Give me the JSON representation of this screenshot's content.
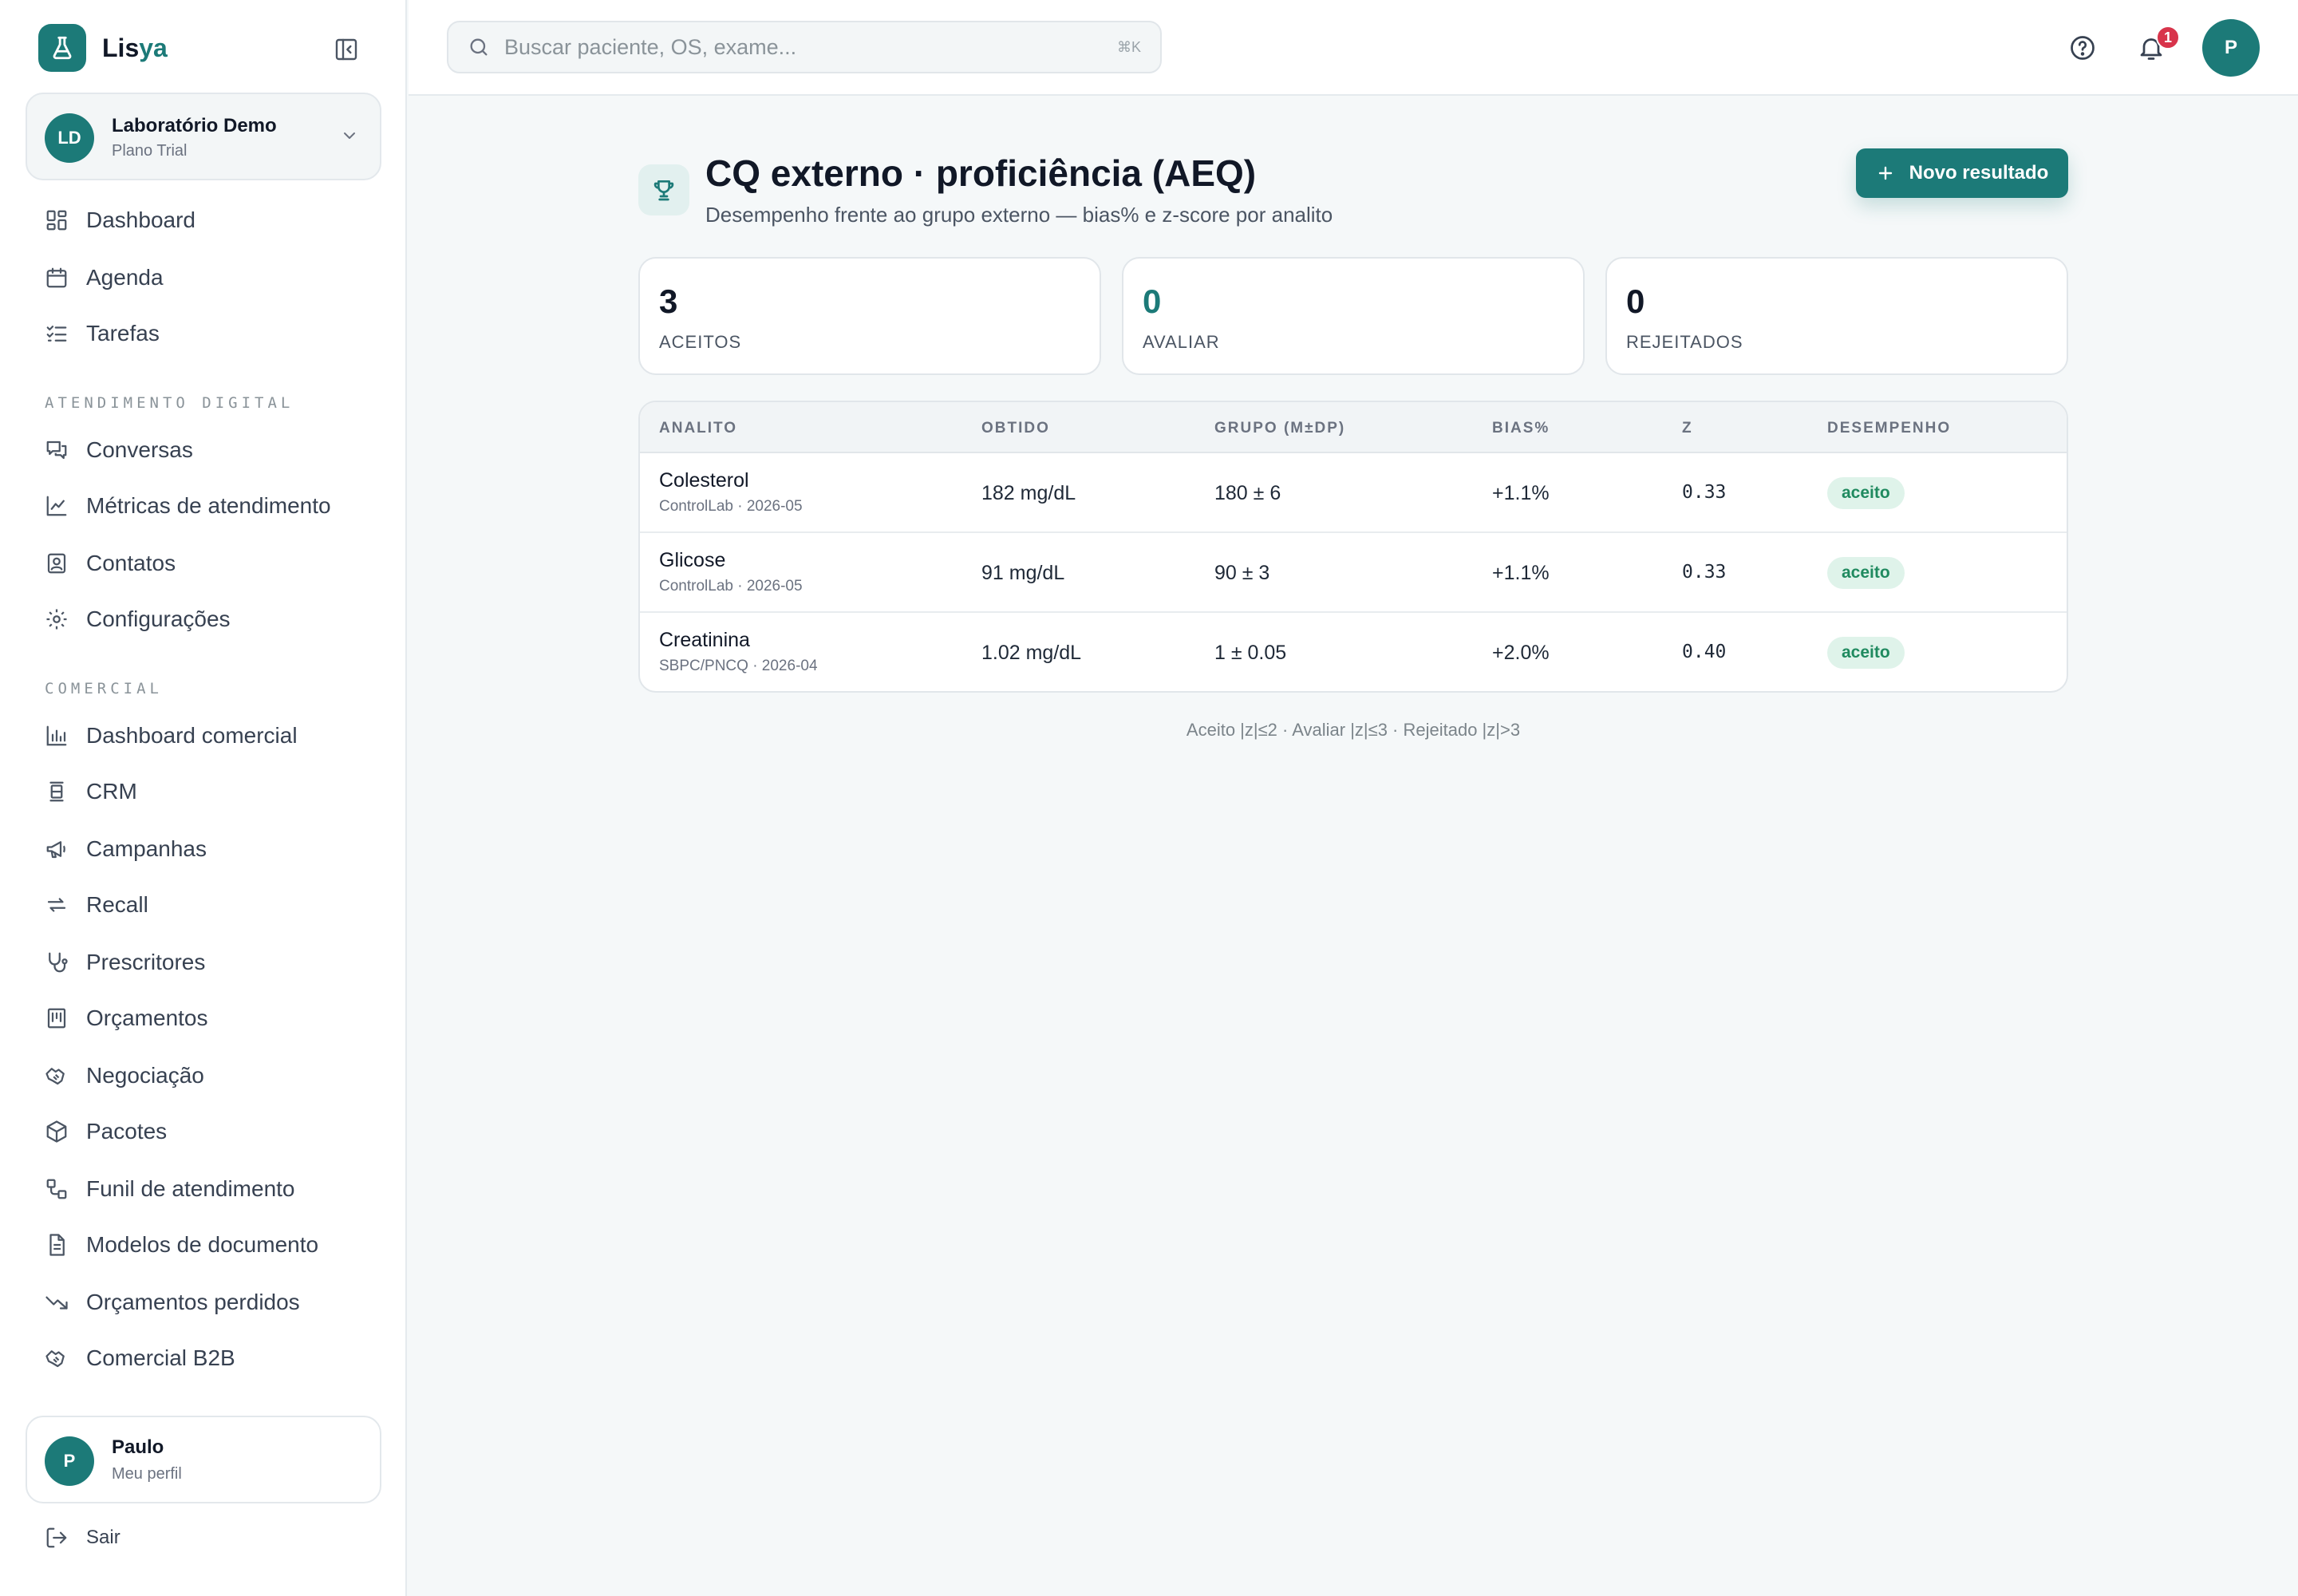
{
  "app": {
    "brand_prefix": "Lis",
    "brand_suffix": "ya"
  },
  "org": {
    "initials": "LD",
    "name": "Laboratório Demo",
    "plan": "Plano Trial"
  },
  "sidebar": {
    "main_items": [
      {
        "label": "Dashboard",
        "icon": "dashboard-grid-icon"
      },
      {
        "label": "Agenda",
        "icon": "calendar-icon"
      },
      {
        "label": "Tarefas",
        "icon": "checklist-icon"
      }
    ],
    "section_digital": "ATENDIMENTO DIGITAL",
    "digital_items": [
      {
        "label": "Conversas",
        "icon": "chat-bubbles-icon"
      },
      {
        "label": "Métricas de atendimento",
        "icon": "line-chart-icon"
      },
      {
        "label": "Contatos",
        "icon": "contact-card-icon"
      },
      {
        "label": "Configurações",
        "icon": "gear-icon"
      }
    ],
    "section_comercial": "COMERCIAL",
    "comercial_items": [
      {
        "label": "Dashboard comercial",
        "icon": "bar-chart-icon"
      },
      {
        "label": "CRM",
        "icon": "crm-icon"
      },
      {
        "label": "Campanhas",
        "icon": "megaphone-icon"
      },
      {
        "label": "Recall",
        "icon": "repeat-arrows-icon"
      },
      {
        "label": "Prescritores",
        "icon": "stethoscope-icon"
      },
      {
        "label": "Orçamentos",
        "icon": "receipt-icon"
      },
      {
        "label": "Negociação",
        "icon": "handshake-icon"
      },
      {
        "label": "Pacotes",
        "icon": "package-icon"
      },
      {
        "label": "Funil de atendimento",
        "icon": "funnel-flow-icon"
      },
      {
        "label": "Modelos de documento",
        "icon": "document-icon"
      },
      {
        "label": "Orçamentos perdidos",
        "icon": "trending-down-icon"
      },
      {
        "label": "Comercial B2B",
        "icon": "handshake-icon"
      }
    ]
  },
  "profile": {
    "initial": "P",
    "name": "Paulo",
    "subtitle": "Meu perfil"
  },
  "logout_label": "Sair",
  "search": {
    "placeholder": "Buscar paciente, OS, exame...",
    "shortcut": "⌘K"
  },
  "topbar": {
    "notification_count": "1",
    "avatar_initial": "P"
  },
  "page": {
    "title": "CQ externo · proficiência (AEQ)",
    "subtitle": "Desempenho frente ao grupo externo — bias% e z-score por analito",
    "primary_action": "Novo resultado"
  },
  "stats": [
    {
      "value": "3",
      "label": "ACEITOS"
    },
    {
      "value": "0",
      "label": "AVALIAR"
    },
    {
      "value": "0",
      "label": "REJEITADOS"
    }
  ],
  "table": {
    "headers": [
      "ANALITO",
      "OBTIDO",
      "GRUPO (M±DP)",
      "BIAS%",
      "Z",
      "DESEMPENHO"
    ],
    "rows": [
      {
        "analito": "Colesterol",
        "fonte": "ControlLab · 2026-05",
        "obtido": "182 mg/dL",
        "grupo": "180 ± 6",
        "bias": "+1.1%",
        "z": "0.33",
        "desempenho": "aceito"
      },
      {
        "analito": "Glicose",
        "fonte": "ControlLab · 2026-05",
        "obtido": "91 mg/dL",
        "grupo": "90 ± 3",
        "bias": "+1.1%",
        "z": "0.33",
        "desempenho": "aceito"
      },
      {
        "analito": "Creatinina",
        "fonte": "SBPC/PNCQ · 2026-04",
        "obtido": "1.02 mg/dL",
        "grupo": "1 ± 0.05",
        "bias": "+2.0%",
        "z": "0.40",
        "desempenho": "aceito"
      }
    ]
  },
  "legend": "Aceito |z|≤2 · Avaliar |z|≤3 · Rejeitado |z|>3",
  "colors": {
    "accent": "#1c7a78",
    "badge_bg": "#dff3ea",
    "badge_text": "#1f8a5f",
    "notification": "#d8344b"
  }
}
